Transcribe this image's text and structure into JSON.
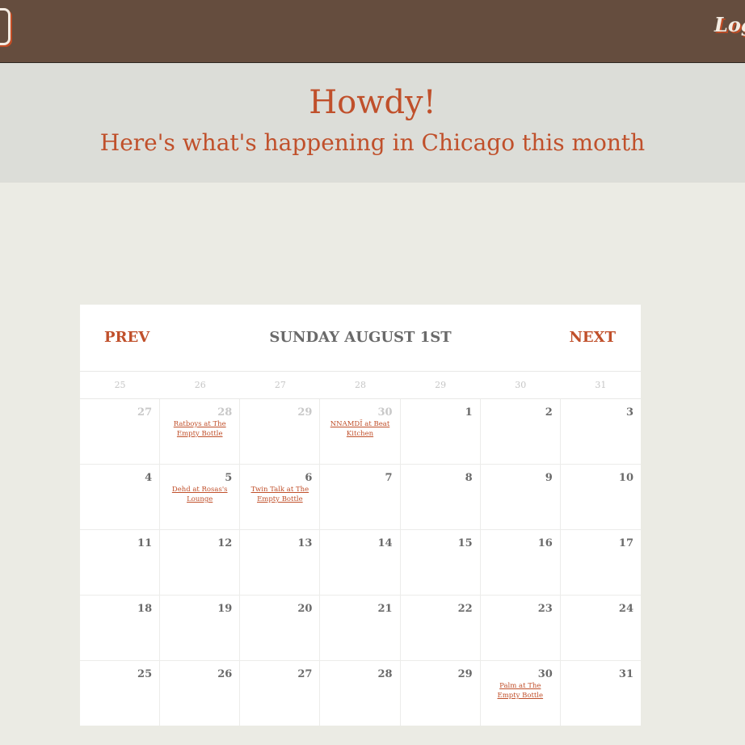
{
  "nav": {
    "login_label": "Log"
  },
  "hero": {
    "title": "Howdy!",
    "subtitle": "Here's what's happening in Chicago this month"
  },
  "calendar": {
    "prev_label": "PREV",
    "next_label": "NEXT",
    "current_date": "SUNDAY AUGUST 1ST",
    "weekdays": [
      "25",
      "26",
      "27",
      "28",
      "29",
      "30",
      "31"
    ],
    "days": [
      {
        "num": "27",
        "muted": true,
        "event": ""
      },
      {
        "num": "28",
        "muted": true,
        "event": "Ratboys at The Empty Bottle"
      },
      {
        "num": "29",
        "muted": true,
        "event": ""
      },
      {
        "num": "30",
        "muted": true,
        "event": "NNAMDÏ at Beat Kitchen"
      },
      {
        "num": "1",
        "muted": false,
        "event": ""
      },
      {
        "num": "2",
        "muted": false,
        "event": ""
      },
      {
        "num": "3",
        "muted": false,
        "event": ""
      },
      {
        "num": "4",
        "muted": false,
        "event": ""
      },
      {
        "num": "5",
        "muted": false,
        "event": "Dehd at Rosas's Lounge"
      },
      {
        "num": "6",
        "muted": false,
        "event": "Twin Talk at The Empty Bottle"
      },
      {
        "num": "7",
        "muted": false,
        "event": ""
      },
      {
        "num": "8",
        "muted": false,
        "event": ""
      },
      {
        "num": "9",
        "muted": false,
        "event": ""
      },
      {
        "num": "10",
        "muted": false,
        "event": ""
      },
      {
        "num": "11",
        "muted": false,
        "event": ""
      },
      {
        "num": "12",
        "muted": false,
        "event": ""
      },
      {
        "num": "13",
        "muted": false,
        "event": ""
      },
      {
        "num": "14",
        "muted": false,
        "event": ""
      },
      {
        "num": "15",
        "muted": false,
        "event": ""
      },
      {
        "num": "16",
        "muted": false,
        "event": ""
      },
      {
        "num": "17",
        "muted": false,
        "event": ""
      },
      {
        "num": "18",
        "muted": false,
        "event": ""
      },
      {
        "num": "19",
        "muted": false,
        "event": ""
      },
      {
        "num": "20",
        "muted": false,
        "event": ""
      },
      {
        "num": "21",
        "muted": false,
        "event": ""
      },
      {
        "num": "22",
        "muted": false,
        "event": ""
      },
      {
        "num": "23",
        "muted": false,
        "event": ""
      },
      {
        "num": "24",
        "muted": false,
        "event": ""
      },
      {
        "num": "25",
        "muted": false,
        "event": ""
      },
      {
        "num": "26",
        "muted": false,
        "event": ""
      },
      {
        "num": "27",
        "muted": false,
        "event": ""
      },
      {
        "num": "28",
        "muted": false,
        "event": ""
      },
      {
        "num": "29",
        "muted": false,
        "event": ""
      },
      {
        "num": "30",
        "muted": false,
        "event": "Palm at The Empty Bottle"
      },
      {
        "num": "31",
        "muted": false,
        "event": ""
      }
    ]
  },
  "colors": {
    "topbar": "#654d3e",
    "accent": "#c0502b",
    "hero_bg": "#dcddd8",
    "page_bg": "#ebebe4"
  },
  "icons": {
    "logo": "logo-icon"
  }
}
